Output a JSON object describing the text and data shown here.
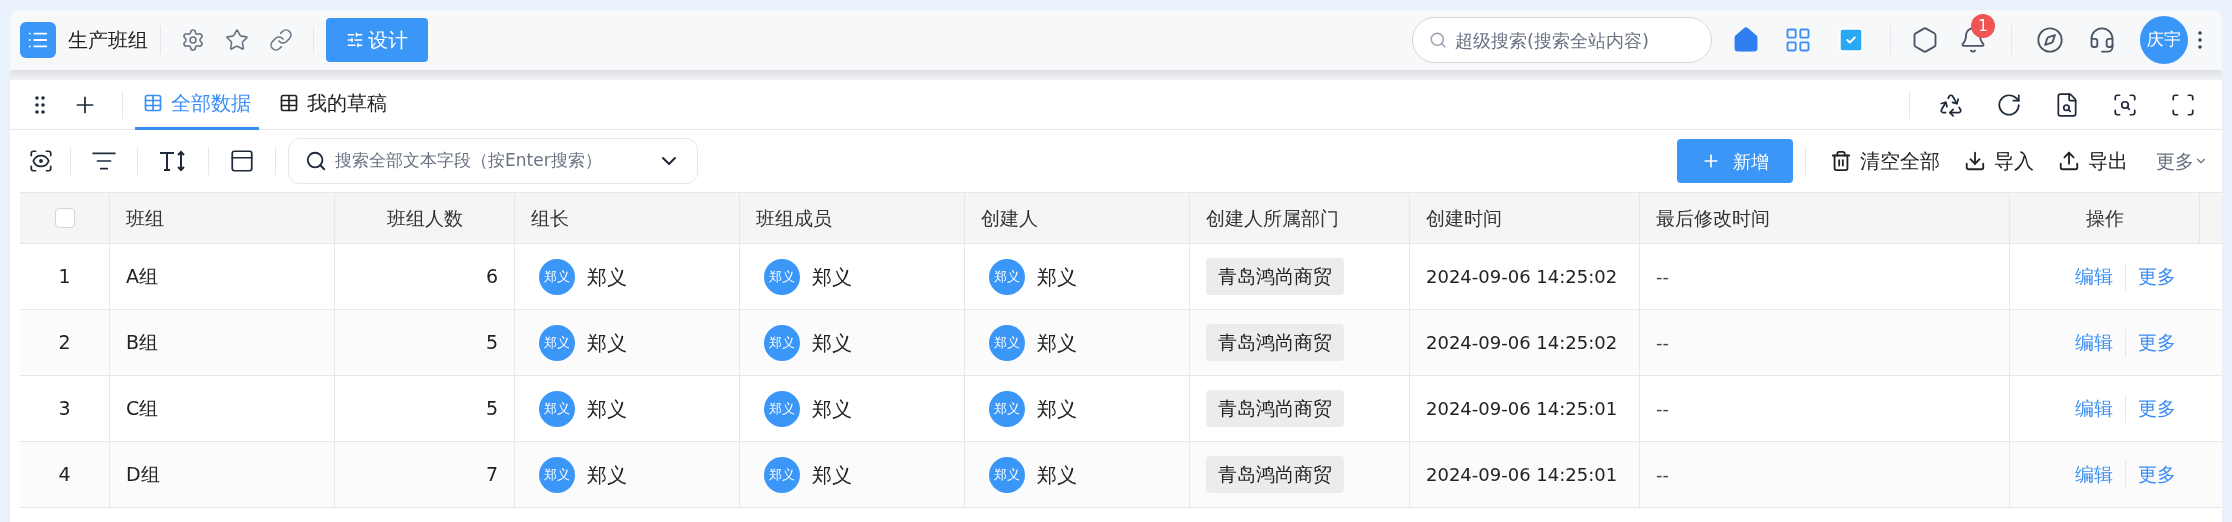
{
  "header": {
    "title": "生产班组",
    "design_button": "设计",
    "search": {
      "placeholder": "超级搜索(搜索全站内容)"
    },
    "notification_count": "1",
    "user_avatar": "庆宇"
  },
  "tabs": [
    {
      "label": "全部数据",
      "selected": true
    },
    {
      "label": "我的草稿",
      "selected": false
    }
  ],
  "toolbar": {
    "search": {
      "placeholder": "搜索全部文本字段（按Enter搜索）"
    },
    "add_button": "新增",
    "actions": [
      {
        "kind": "trash",
        "label": "清空全部"
      },
      {
        "kind": "import",
        "label": "导入"
      },
      {
        "kind": "export",
        "label": "导出"
      }
    ],
    "more": "更多"
  },
  "table": {
    "select_all": {
      "checked": false
    },
    "columns": [
      {
        "label": "班组"
      },
      {
        "label": "班组人数"
      },
      {
        "label": "组长"
      },
      {
        "label": "班组成员"
      },
      {
        "label": "创建人"
      },
      {
        "label": "创建人所属部门"
      },
      {
        "label": "创建时间"
      },
      {
        "label": "最后修改时间"
      },
      {
        "label": "操作"
      }
    ],
    "rows": [
      {
        "index": "1",
        "group": "A组",
        "count": "6",
        "leader": {
          "avatar": "郑义",
          "name": "郑义"
        },
        "members": {
          "avatar": "郑义",
          "name": "郑义"
        },
        "creator": {
          "avatar": "郑义",
          "name": "郑义"
        },
        "department": "青岛鸿尚商贸",
        "created": "2024-09-06 14:25:02",
        "modified": "--",
        "actions": [
          "编辑",
          "更多"
        ]
      },
      {
        "index": "2",
        "group": "B组",
        "count": "5",
        "leader": {
          "avatar": "郑义",
          "name": "郑义"
        },
        "members": {
          "avatar": "郑义",
          "name": "郑义"
        },
        "creator": {
          "avatar": "郑义",
          "name": "郑义"
        },
        "department": "青岛鸿尚商贸",
        "created": "2024-09-06 14:25:02",
        "modified": "--",
        "actions": [
          "编辑",
          "更多"
        ]
      },
      {
        "index": "3",
        "group": "C组",
        "count": "5",
        "leader": {
          "avatar": "郑义",
          "name": "郑义"
        },
        "members": {
          "avatar": "郑义",
          "name": "郑义"
        },
        "creator": {
          "avatar": "郑义",
          "name": "郑义"
        },
        "department": "青岛鸿尚商贸",
        "created": "2024-09-06 14:25:01",
        "modified": "--",
        "actions": [
          "编辑",
          "更多"
        ]
      },
      {
        "index": "4",
        "group": "D组",
        "count": "7",
        "leader": {
          "avatar": "郑义",
          "name": "郑义"
        },
        "members": {
          "avatar": "郑义",
          "name": "郑义"
        },
        "creator": {
          "avatar": "郑义",
          "name": "郑义"
        },
        "department": "青岛鸿尚商贸",
        "created": "2024-09-06 14:25:01",
        "modified": "--",
        "actions": [
          "编辑",
          "更多"
        ]
      }
    ]
  }
}
